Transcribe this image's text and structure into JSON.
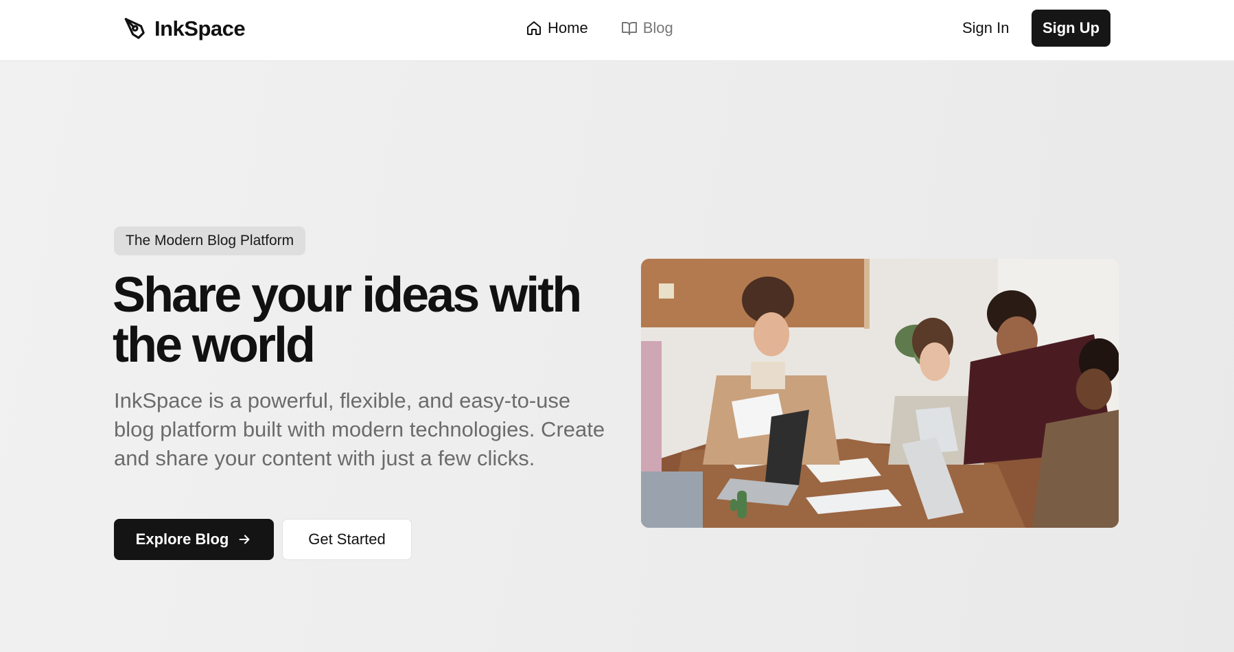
{
  "header": {
    "brand": "InkSpace",
    "nav": [
      {
        "label": "Home",
        "icon": "home-icon"
      },
      {
        "label": "Blog",
        "icon": "book-open-icon"
      }
    ],
    "sign_in": "Sign In",
    "sign_up": "Sign Up"
  },
  "hero": {
    "badge": "The Modern Blog Platform",
    "headline_line1": "Share your ideas with",
    "headline_line2": "the world",
    "description": "InkSpace is a powerful, flexible, and easy-to-use blog platform built with modern technologies. Create and share your content with just a few clicks.",
    "primary_cta": "Explore Blog",
    "secondary_cta": "Get Started",
    "image_subject": "team-meeting-photo"
  },
  "colors": {
    "primary_button": "#141414",
    "page_background": "#efefef",
    "header_background": "#ffffff",
    "muted_text": "#6b6b6b"
  }
}
